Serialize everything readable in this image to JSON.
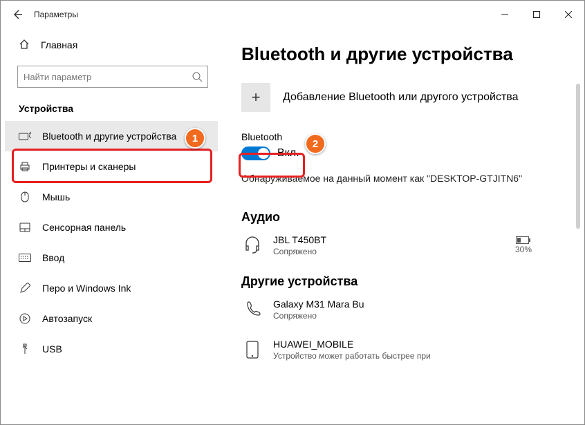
{
  "titlebar": {
    "title": "Параметры"
  },
  "sidebar": {
    "home": "Главная",
    "search_placeholder": "Найти параметр",
    "section": "Устройства",
    "items": [
      {
        "label": "Bluetooth и другие устройства",
        "icon": "keyboard-bt-icon",
        "active": true
      },
      {
        "label": "Принтеры и сканеры",
        "icon": "printer-icon"
      },
      {
        "label": "Мышь",
        "icon": "mouse-icon"
      },
      {
        "label": "Сенсорная панель",
        "icon": "touchpad-icon"
      },
      {
        "label": "Ввод",
        "icon": "keyboard-icon"
      },
      {
        "label": "Перо и Windows Ink",
        "icon": "pen-icon"
      },
      {
        "label": "Автозапуск",
        "icon": "autoplay-icon"
      },
      {
        "label": "USB",
        "icon": "usb-icon"
      }
    ]
  },
  "main": {
    "heading": "Bluetooth и другие устройства",
    "add_device": "Добавление Bluetooth или другого устройства",
    "bt_label": "Bluetooth",
    "toggle_state": "Вкл.",
    "discoverable": "Обнаруживаемое на данный момент как \"DESKTOP-GTJITN6\"",
    "audio_heading": "Аудио",
    "audio_device": {
      "name": "JBL T450BT",
      "status": "Сопряжено",
      "battery": "30%"
    },
    "other_heading": "Другие устройства",
    "other1": {
      "name": "Galaxy M31 Mara Bu",
      "status": "Сопряжено"
    },
    "other2": {
      "name": "HUAWEI_MOBILE",
      "status": "Устройство может работать быстрее при"
    }
  },
  "badges": {
    "b1": "1",
    "b2": "2"
  }
}
